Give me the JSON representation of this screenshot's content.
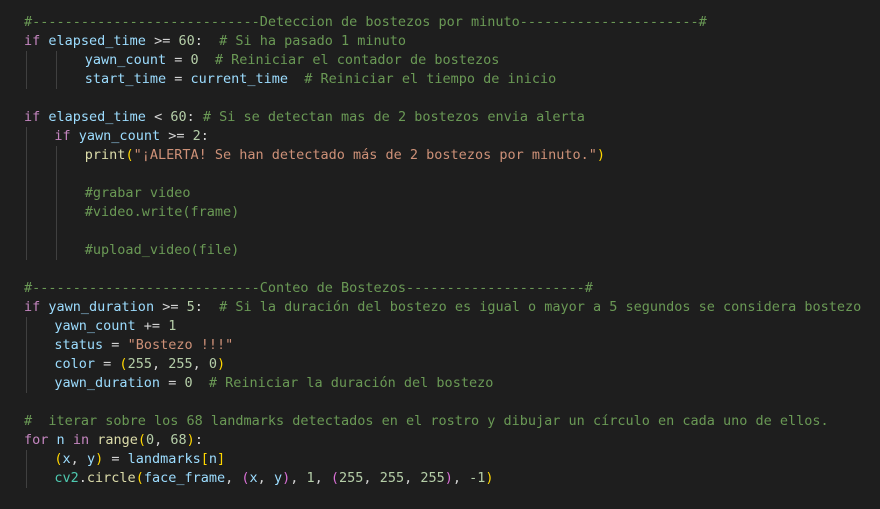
{
  "editor": {
    "colors": {
      "background": "#1e1e1e",
      "keyword": "#c586c0",
      "variable": "#9cdcfe",
      "number": "#b5cea8",
      "comment": "#6a9955",
      "string": "#ce9178",
      "function": "#dcdcaa",
      "operator": "#d4d4d4",
      "bracket_level_1": "#ffd700",
      "bracket_level_2": "#da70d6",
      "bracket_level_3": "#179fff",
      "class": "#4ec9b0"
    },
    "lines": [
      {
        "row": 0,
        "indent": 0,
        "tokens": [
          {
            "t": "#----------------------------Deteccion de bostezos por minuto----------------------#",
            "k": "com"
          }
        ]
      },
      {
        "row": 1,
        "indent": 0,
        "tokens": [
          {
            "t": "if",
            "k": "kw"
          },
          {
            "t": " ",
            "k": "op"
          },
          {
            "t": "elapsed_time",
            "k": "var"
          },
          {
            "t": " >= ",
            "k": "op"
          },
          {
            "t": "60",
            "k": "num"
          },
          {
            "t": ":  ",
            "k": "op"
          },
          {
            "t": "# Si ha pasado 1 minuto",
            "k": "com"
          }
        ]
      },
      {
        "row": 2,
        "indent": 8,
        "tokens": [
          {
            "t": "yawn_count",
            "k": "var"
          },
          {
            "t": " = ",
            "k": "op"
          },
          {
            "t": "0",
            "k": "num"
          },
          {
            "t": "  ",
            "k": "op"
          },
          {
            "t": "# Reiniciar el contador de bostezos",
            "k": "com"
          }
        ]
      },
      {
        "row": 3,
        "indent": 8,
        "tokens": [
          {
            "t": "start_time",
            "k": "var"
          },
          {
            "t": " = ",
            "k": "op"
          },
          {
            "t": "current_time",
            "k": "var"
          },
          {
            "t": "  ",
            "k": "op"
          },
          {
            "t": "# Reiniciar el tiempo de inicio",
            "k": "com"
          }
        ]
      },
      {
        "row": 5,
        "indent": 0,
        "tokens": [
          {
            "t": "if",
            "k": "kw"
          },
          {
            "t": " ",
            "k": "op"
          },
          {
            "t": "elapsed_time",
            "k": "var"
          },
          {
            "t": " < ",
            "k": "op"
          },
          {
            "t": "60",
            "k": "num"
          },
          {
            "t": ": ",
            "k": "op"
          },
          {
            "t": "# Si se detectan mas de 2 bostezos envia alerta",
            "k": "com"
          }
        ]
      },
      {
        "row": 6,
        "indent": 4,
        "tokens": [
          {
            "t": "if",
            "k": "kw"
          },
          {
            "t": " ",
            "k": "op"
          },
          {
            "t": "yawn_count",
            "k": "var"
          },
          {
            "t": " >= ",
            "k": "op"
          },
          {
            "t": "2",
            "k": "num"
          },
          {
            "t": ":",
            "k": "op"
          }
        ]
      },
      {
        "row": 7,
        "indent": 8,
        "tokens": [
          {
            "t": "print",
            "k": "fn"
          },
          {
            "t": "(",
            "k": "b1"
          },
          {
            "t": "\"¡ALERTA! Se han detectado más de 2 bostezos por minuto.\"",
            "k": "str"
          },
          {
            "t": ")",
            "k": "b1"
          }
        ]
      },
      {
        "row": 9,
        "indent": 8,
        "tokens": [
          {
            "t": "#grabar video",
            "k": "com"
          }
        ]
      },
      {
        "row": 10,
        "indent": 8,
        "tokens": [
          {
            "t": "#video.write(frame)",
            "k": "com"
          }
        ]
      },
      {
        "row": 12,
        "indent": 8,
        "tokens": [
          {
            "t": "#upload_video(file)",
            "k": "com"
          }
        ]
      },
      {
        "row": 14,
        "indent": 0,
        "tokens": [
          {
            "t": "#----------------------------Conteo de Bostezos----------------------#",
            "k": "com"
          }
        ]
      },
      {
        "row": 15,
        "indent": 0,
        "tokens": [
          {
            "t": "if",
            "k": "kw"
          },
          {
            "t": " ",
            "k": "op"
          },
          {
            "t": "yawn_duration",
            "k": "var"
          },
          {
            "t": " >= ",
            "k": "op"
          },
          {
            "t": "5",
            "k": "num"
          },
          {
            "t": ":  ",
            "k": "op"
          },
          {
            "t": "# Si la duración del bostezo es igual o mayor a 5 segundos se considera bostezo",
            "k": "com"
          }
        ]
      },
      {
        "row": 16,
        "indent": 4,
        "tokens": [
          {
            "t": "yawn_count",
            "k": "var"
          },
          {
            "t": " += ",
            "k": "op"
          },
          {
            "t": "1",
            "k": "num"
          }
        ]
      },
      {
        "row": 17,
        "indent": 4,
        "tokens": [
          {
            "t": "status",
            "k": "var"
          },
          {
            "t": " = ",
            "k": "op"
          },
          {
            "t": "\"Bostezo !!!\"",
            "k": "str"
          }
        ]
      },
      {
        "row": 18,
        "indent": 4,
        "tokens": [
          {
            "t": "color",
            "k": "var"
          },
          {
            "t": " = ",
            "k": "op"
          },
          {
            "t": "(",
            "k": "b1"
          },
          {
            "t": "255",
            "k": "num"
          },
          {
            "t": ", ",
            "k": "op"
          },
          {
            "t": "255",
            "k": "num"
          },
          {
            "t": ", ",
            "k": "op"
          },
          {
            "t": "0",
            "k": "num"
          },
          {
            "t": ")",
            "k": "b1"
          }
        ]
      },
      {
        "row": 19,
        "indent": 4,
        "tokens": [
          {
            "t": "yawn_duration",
            "k": "var"
          },
          {
            "t": " = ",
            "k": "op"
          },
          {
            "t": "0",
            "k": "num"
          },
          {
            "t": "  ",
            "k": "op"
          },
          {
            "t": "# Reiniciar la duración del bostezo",
            "k": "com"
          }
        ]
      },
      {
        "row": 21,
        "indent": 0,
        "tokens": [
          {
            "t": "#  iterar sobre los 68 landmarks detectados en el rostro y dibujar un círculo en cada uno de ellos.",
            "k": "com"
          }
        ]
      },
      {
        "row": 22,
        "indent": 0,
        "tokens": [
          {
            "t": "for",
            "k": "kw"
          },
          {
            "t": " ",
            "k": "op"
          },
          {
            "t": "n",
            "k": "var"
          },
          {
            "t": " ",
            "k": "op"
          },
          {
            "t": "in",
            "k": "kw"
          },
          {
            "t": " ",
            "k": "op"
          },
          {
            "t": "range",
            "k": "fn"
          },
          {
            "t": "(",
            "k": "b1"
          },
          {
            "t": "0",
            "k": "num"
          },
          {
            "t": ", ",
            "k": "op"
          },
          {
            "t": "68",
            "k": "num"
          },
          {
            "t": ")",
            "k": "b1"
          },
          {
            "t": ":",
            "k": "op"
          }
        ]
      },
      {
        "row": 23,
        "indent": 4,
        "tokens": [
          {
            "t": "(",
            "k": "b1"
          },
          {
            "t": "x",
            "k": "var"
          },
          {
            "t": ", ",
            "k": "op"
          },
          {
            "t": "y",
            "k": "var"
          },
          {
            "t": ")",
            "k": "b1"
          },
          {
            "t": " = ",
            "k": "op"
          },
          {
            "t": "landmarks",
            "k": "var"
          },
          {
            "t": "[",
            "k": "b1"
          },
          {
            "t": "n",
            "k": "var"
          },
          {
            "t": "]",
            "k": "b1"
          }
        ]
      },
      {
        "row": 24,
        "indent": 4,
        "tokens": [
          {
            "t": "cv2",
            "k": "cls"
          },
          {
            "t": ".",
            "k": "op"
          },
          {
            "t": "circle",
            "k": "fn"
          },
          {
            "t": "(",
            "k": "b1"
          },
          {
            "t": "face_frame",
            "k": "var"
          },
          {
            "t": ", ",
            "k": "op"
          },
          {
            "t": "(",
            "k": "b2"
          },
          {
            "t": "x",
            "k": "var"
          },
          {
            "t": ", ",
            "k": "op"
          },
          {
            "t": "y",
            "k": "var"
          },
          {
            "t": ")",
            "k": "b2"
          },
          {
            "t": ", ",
            "k": "op"
          },
          {
            "t": "1",
            "k": "num"
          },
          {
            "t": ", ",
            "k": "op"
          },
          {
            "t": "(",
            "k": "b2"
          },
          {
            "t": "255",
            "k": "num"
          },
          {
            "t": ", ",
            "k": "op"
          },
          {
            "t": "255",
            "k": "num"
          },
          {
            "t": ", ",
            "k": "op"
          },
          {
            "t": "255",
            "k": "num"
          },
          {
            "t": ")",
            "k": "b2"
          },
          {
            "t": ", ",
            "k": "op"
          },
          {
            "t": "-1",
            "k": "num"
          },
          {
            "t": ")",
            "k": "b1"
          }
        ]
      }
    ]
  }
}
